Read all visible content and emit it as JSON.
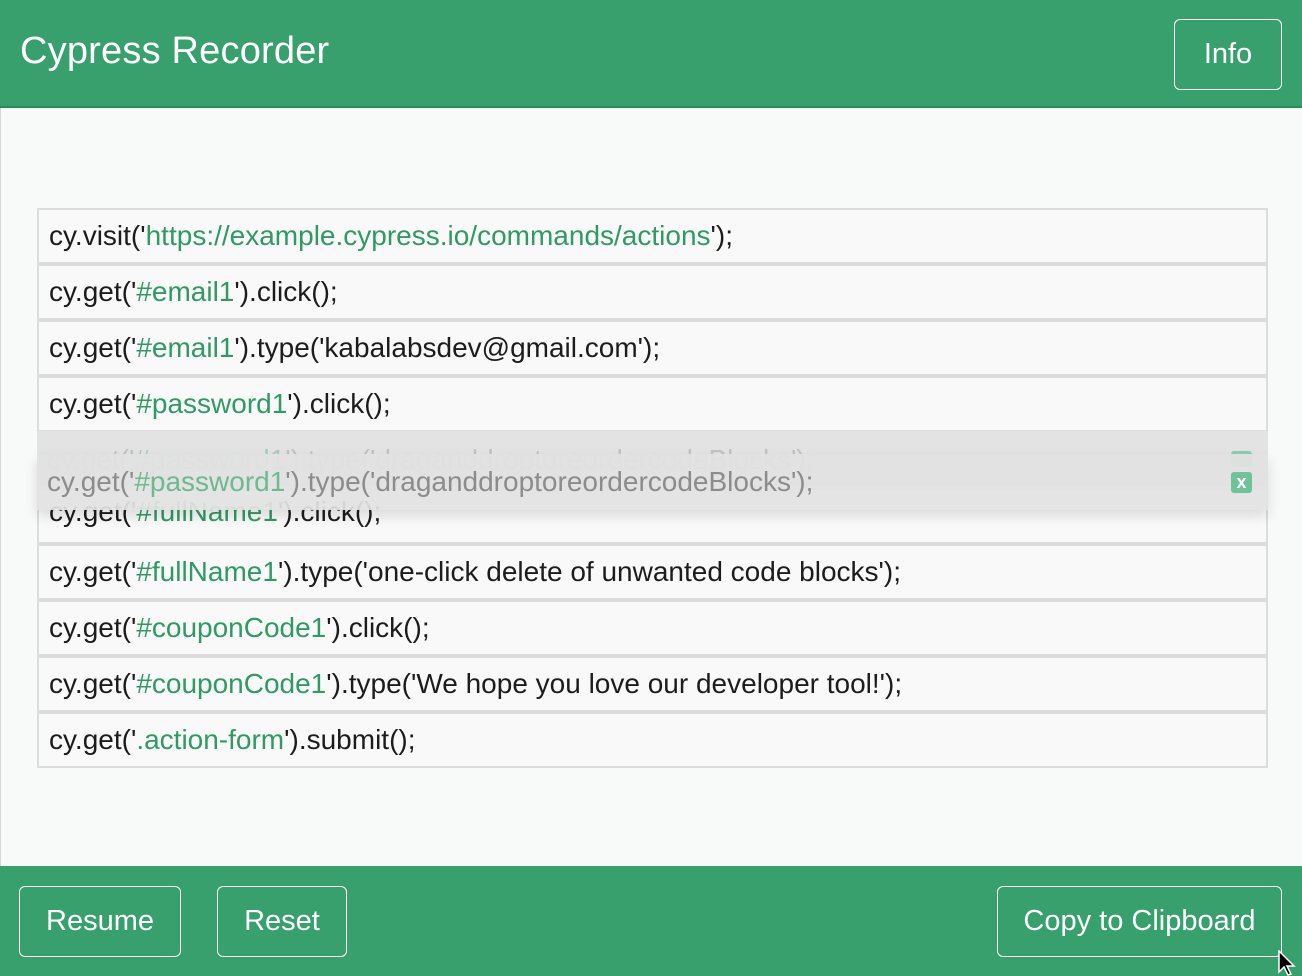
{
  "header": {
    "title": "Cypress Recorder",
    "info_label": "Info"
  },
  "code_lines": [
    {
      "pre": "cy.visit(",
      "q1": "'",
      "str": "https://example.cypress.io/commands/actions",
      "q2": "'",
      "post": ");"
    },
    {
      "pre": "cy.get(",
      "q1": "'",
      "str": "#email1",
      "q2": "'",
      "post": ").click();"
    },
    {
      "pre": "cy.get(",
      "q1": "'",
      "str": "#email1",
      "q2": "'",
      "post": ").type('kabalabsdev@gmail.com');"
    },
    {
      "pre": "cy.get(",
      "q1": "'",
      "str": "#password1",
      "q2": "'",
      "post": ").click();"
    },
    {
      "pre": "cy.get(",
      "q1": "'",
      "str": "#fullName1",
      "q2": "'",
      "post": ").click();"
    },
    {
      "pre": "cy.get(",
      "q1": "'",
      "str": "#fullName1",
      "q2": "'",
      "post": ").type('one-click delete of unwanted code blocks');"
    },
    {
      "pre": "cy.get(",
      "q1": "'",
      "str": "#couponCode1",
      "q2": "'",
      "post": ").click();"
    },
    {
      "pre": "cy.get(",
      "q1": "'",
      "str": "#couponCode1",
      "q2": "'",
      "post": ").type('We hope you love our developer tool!');"
    },
    {
      "pre": "cy.get(",
      "q1": "'",
      "str": ".action-form",
      "q2": "'",
      "post": ").submit();"
    }
  ],
  "dragging_line": {
    "pre": "cy.get(",
    "q1": "'",
    "str": "#password1",
    "q2": "'",
    "post": ").type('draganddroptoreordercodeBlocks');"
  },
  "delete_label": "x",
  "footer": {
    "resume_label": "Resume",
    "reset_label": "Reset",
    "copy_label": "Copy to Clipboard"
  },
  "colors": {
    "brand": "#38a06c",
    "string": "#2f9a64"
  }
}
